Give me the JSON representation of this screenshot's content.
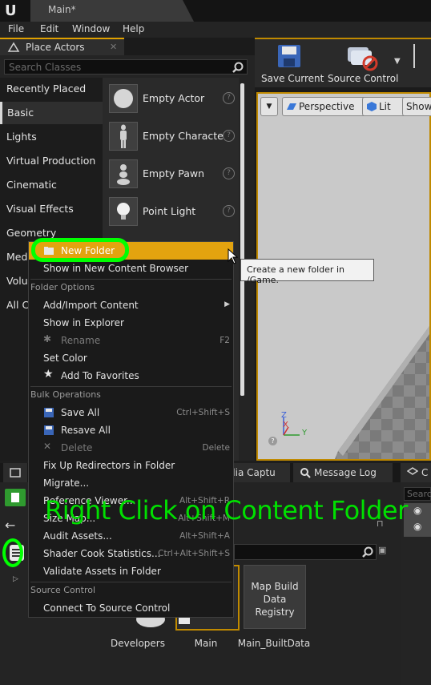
{
  "window": {
    "tab_title": "Main*"
  },
  "menubar": [
    "File",
    "Edit",
    "Window",
    "Help"
  ],
  "place_actors": {
    "title": "Place Actors",
    "search_placeholder": "Search Classes",
    "categories": [
      "Recently Placed",
      "Basic",
      "Lights",
      "Virtual Production",
      "Cinematic",
      "Visual Effects",
      "Geometry",
      "Medi",
      "Volu",
      "All Cl"
    ],
    "active_category": "Basic",
    "actors": [
      "Empty Actor",
      "Empty Characte",
      "Empty Pawn",
      "Point Light"
    ]
  },
  "toolbar": {
    "save_current": "Save Current",
    "source_control": "Source Control"
  },
  "viewport": {
    "perspective": "Perspective",
    "lit": "Lit",
    "show": "Show",
    "axis_z": "Z",
    "axis_x": "X",
    "axis_y": "Y"
  },
  "context_menu": {
    "new_folder": "New Folder",
    "show_in_cb": "Show in New Content Browser",
    "folder_options_header": "Folder Options",
    "add_import": "Add/Import Content",
    "show_in_explorer": "Show in Explorer",
    "rename": "Rename",
    "rename_shortcut": "F2",
    "set_color": "Set Color",
    "add_to_favorites": "Add To Favorites",
    "bulk_header": "Bulk Operations",
    "save_all": "Save All",
    "save_all_shortcut": "Ctrl+Shift+S",
    "resave_all": "Resave All",
    "delete": "Delete",
    "delete_shortcut": "Delete",
    "fix_redirectors": "Fix Up Redirectors in Folder",
    "migrate": "Migrate...",
    "reference_viewer": "Reference Viewer...",
    "reference_viewer_shortcut": "Alt+Shift+R",
    "size_map": "Size Map...",
    "size_map_shortcut": "Alt+Shift+M",
    "audit_assets": "Audit Assets...",
    "audit_assets_shortcut": "Alt+Shift+A",
    "shader_cook": "Shader Cook Statistics...",
    "shader_cook_shortcut": "Ctrl+Alt+Shift+S",
    "validate_assets": "Validate Assets in Folder",
    "source_control_header": "Source Control",
    "connect_sc": "Connect To Source Control"
  },
  "tooltip": "Create a new folder in /Game.",
  "bottom_tabs": {
    "media_capture": "dia Captu",
    "message_log": "Message Log",
    "right_tab": "C"
  },
  "content_browser": {
    "right_search": "Searc",
    "assets": [
      {
        "label": "Developers"
      },
      {
        "label": "Main"
      },
      {
        "label": "Main_BuiltData",
        "thumb_text": "Map Build Data Registry"
      }
    ]
  },
  "annotation": "Right Click on Content Folder",
  "colors": {
    "accent": "#e3a30f",
    "annotation": "#00e000"
  }
}
